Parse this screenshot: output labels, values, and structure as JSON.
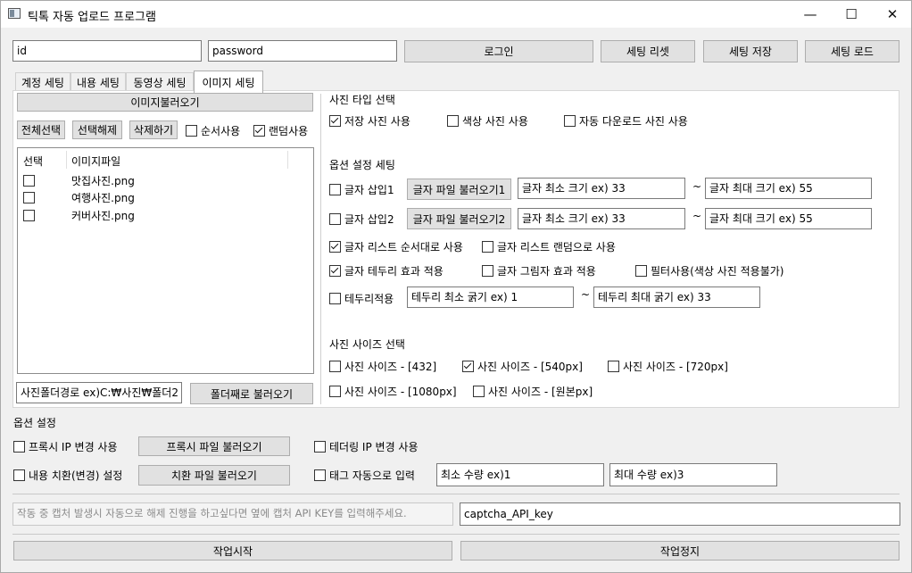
{
  "window": {
    "title": "틱톡 자동 업로드 프로그램",
    "min": "—",
    "max": "☐",
    "close": "✕"
  },
  "top": {
    "id_value": "id",
    "password_value": "password",
    "login": "로그인",
    "reset": "세팅 리셋",
    "save": "세팅 저장",
    "load": "세팅 로드"
  },
  "tabs": [
    "계정 세팅",
    "내용 세팅",
    "동영상 세팅",
    "이미지 세팅"
  ],
  "left": {
    "load_images": "이미지불러오기",
    "select_all": "전체선택",
    "deselect": "선택해제",
    "delete": "삭제하기",
    "order_use": "순서사용",
    "random_use": "랜덤사용",
    "col_select": "선택",
    "col_file": "이미지파일",
    "files": [
      "맛집사진.png",
      "여행사진.png",
      "커버사진.png"
    ],
    "folder_path": "사진폴더경로 ex)C:₩사진₩폴더2",
    "load_folder": "폴더째로 불러오기"
  },
  "right": {
    "photo_type_title": "사진 타입 선택",
    "saved_photo": "저장 사진 사용",
    "color_photo": "색상 사진 사용",
    "auto_download_photo": "자동 다운로드 사진 사용",
    "option_title": "옵션 설정 세팅",
    "text_insert1": "글자 삽입1",
    "text_insert2": "글자 삽입2",
    "load_text_file1": "글자 파일 불러오기1",
    "load_text_file2": "글자 파일 불러오기2",
    "min_size1": "글자 최소 크기 ex) 33",
    "max_size1": "글자 최대 크기 ex) 55",
    "min_size2": "글자 최소 크기 ex) 33",
    "max_size2": "글자 최대 크기 ex) 55",
    "tilde": "~",
    "list_order": "글자 리스트 순서대로 사용",
    "list_random": "글자 리스트 랜덤으로 사용",
    "text_border": "글자 테두리 효과 적용",
    "text_shadow": "글자 그림자 효과 적용",
    "filter_use": "필터사용(색상 사진 적용불가)",
    "border_apply": "테두리적용",
    "border_min": "테두리 최소 굵기 ex) 1",
    "border_max": "테두리 최대 굵기 ex) 33",
    "size_title": "사진 사이즈 선택",
    "size_432": "사진 사이즈 - [432]",
    "size_540": "사진 사이즈 - [540px]",
    "size_720": "사진 사이즈 - [720px]",
    "size_1080": "사진 사이즈 - [1080px]",
    "size_original": "사진 사이즈 - [원본px]"
  },
  "options": {
    "title": "옵션 설정",
    "proxy_ip": "프록시 IP 변경 사용",
    "load_proxy": "프록시 파일 불러오기",
    "tethering_ip": "테더링 IP 변경 사용",
    "replace_content": "내용 치환(변경) 설정",
    "load_replace": "치환 파일 불러오기",
    "auto_tags": "태그 자동으로 입력",
    "min_count": "최소 수량 ex)1",
    "max_count": "최대 수량 ex)3"
  },
  "captcha": {
    "hint": "작동 중 캡처 발생시 자동으로 해제 진행을 하고싶다면 옆에 캡처 API KEY를 입력해주세요.",
    "api_key": "captcha_API_key"
  },
  "bottom": {
    "start": "작업시작",
    "stop": "작업정지"
  }
}
